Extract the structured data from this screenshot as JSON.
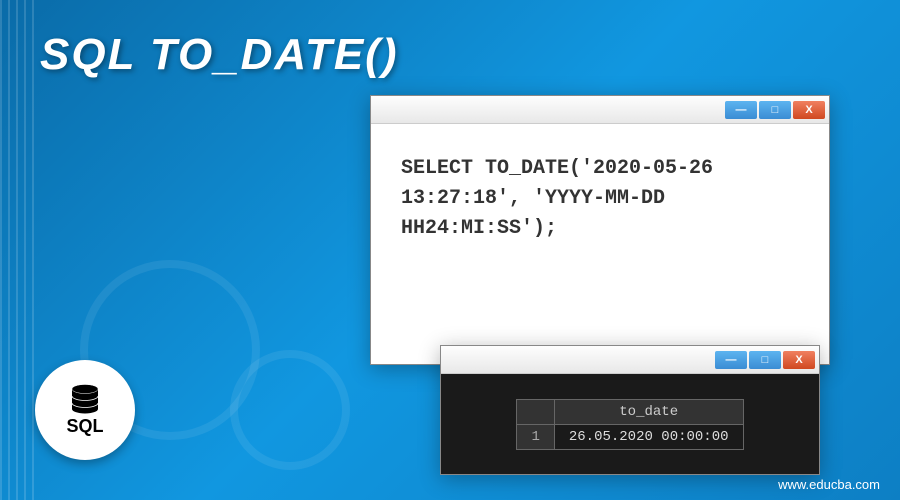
{
  "title": "SQL TO_DATE()",
  "sqlBadge": {
    "label": "SQL"
  },
  "codeWindow": {
    "line1": "SELECT TO_DATE('2020-05-26",
    "line2": "13:27:18', 'YYYY-MM-DD",
    "line3": "HH24:MI:SS');"
  },
  "resultWindow": {
    "header": "to_date",
    "rowNum": "1",
    "value": "26.05.2020 00:00:00"
  },
  "windowButtons": {
    "minimize": "—",
    "maximize": "□",
    "close": "X"
  },
  "website": "www.educba.com"
}
